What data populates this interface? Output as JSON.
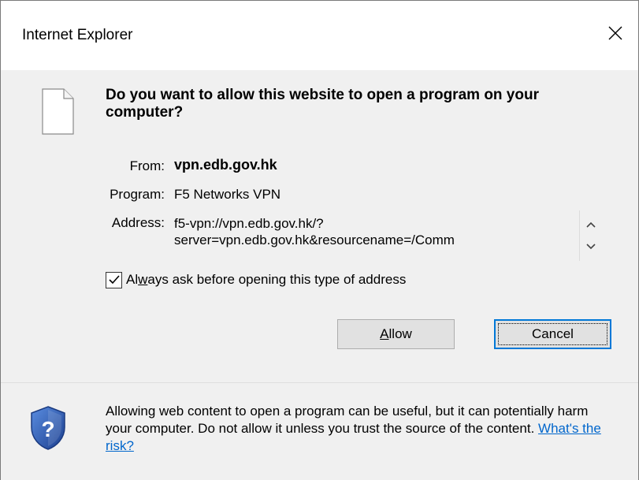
{
  "window": {
    "title": "Internet Explorer",
    "close_icon": "close-icon"
  },
  "dialog": {
    "question": "Do you want to allow this website to open a program on your computer?",
    "from_label": "From:",
    "from_value": "vpn.edb.gov.hk",
    "program_label": "Program:",
    "program_value": "F5 Networks VPN",
    "address_label": "Address:",
    "address_line1": "f5-vpn://vpn.edb.gov.hk/?",
    "address_line2": "server=vpn.edb.gov.hk&resourcename=/Comm",
    "checkbox": {
      "checked": true,
      "label_pre": "Al",
      "label_ul": "w",
      "label_post": "ays ask before opening this type of address"
    },
    "allow_button": {
      "ul": "A",
      "rest": "llow"
    },
    "cancel_button": "Cancel"
  },
  "footer": {
    "text": "Allowing web content to open a program can be useful, but it can potentially harm your computer. Do not allow it unless you trust the source of the content.",
    "link": "What's the risk?"
  },
  "icons": {
    "document": "document-icon",
    "shield": "security-shield-icon"
  },
  "colors": {
    "link": "#0066cc",
    "focus": "#0078d7",
    "shield": "#2b5fb5"
  }
}
